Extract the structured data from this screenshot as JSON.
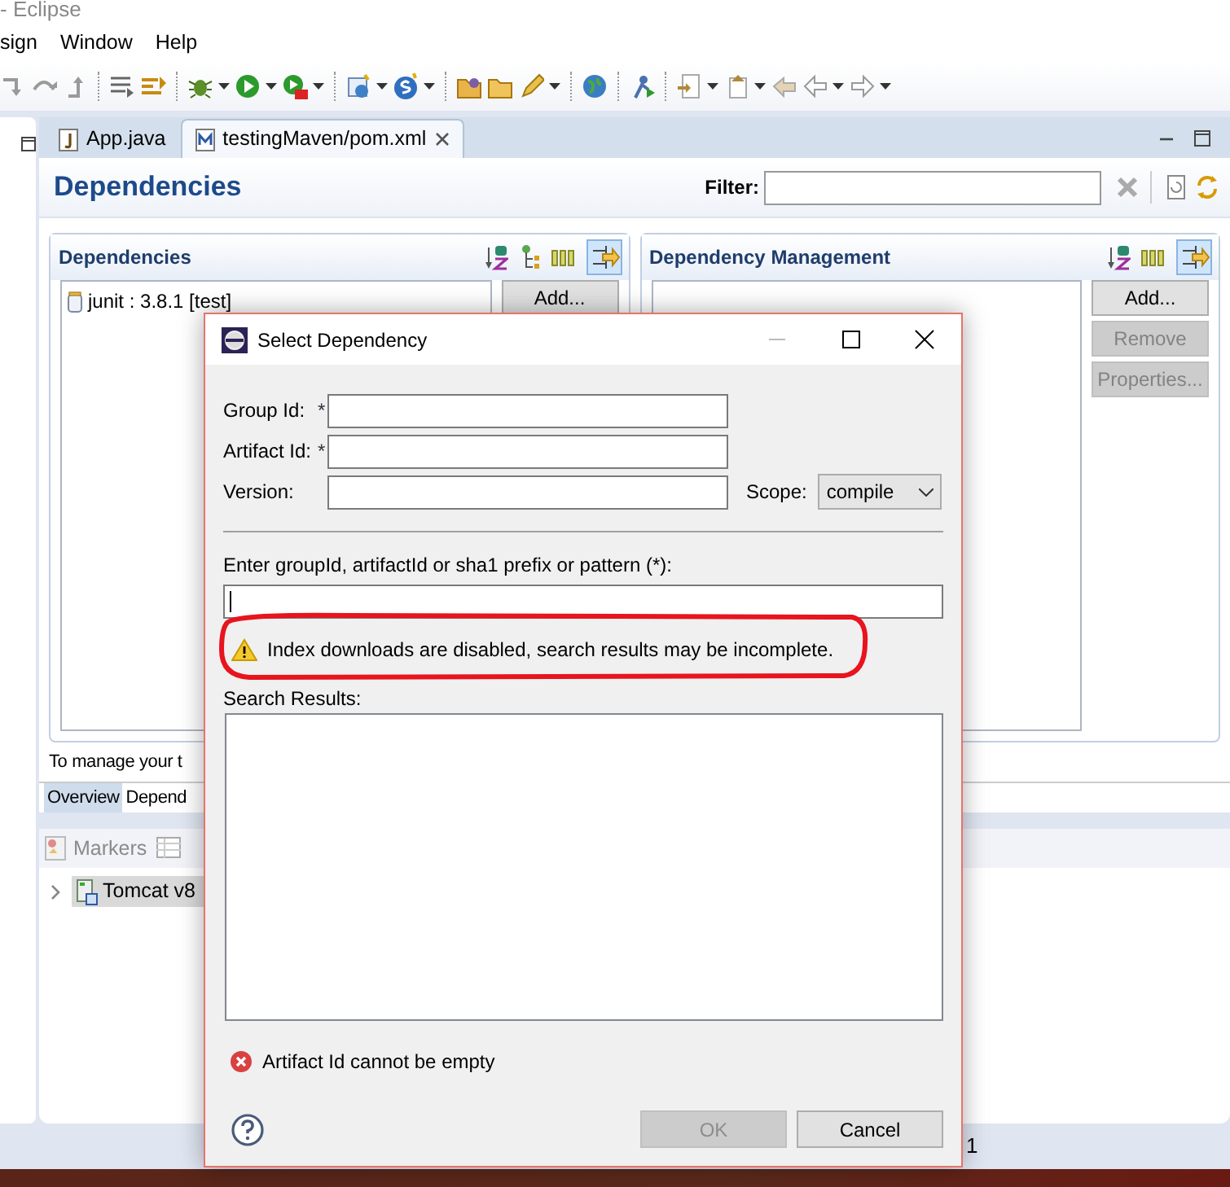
{
  "window": {
    "title": "- Eclipse"
  },
  "menu": [
    {
      "label": "sign"
    },
    {
      "label": "Window"
    },
    {
      "label": "Help"
    }
  ],
  "editor_tabs": [
    {
      "label": "App.java",
      "kind": "java",
      "selected": false,
      "closable": false
    },
    {
      "label": "testingMaven/pom.xml",
      "kind": "maven",
      "selected": true,
      "closable": true
    }
  ],
  "editor": {
    "title": "Dependencies",
    "filter_label": "Filter:"
  },
  "sections": [
    {
      "title": "Dependencies",
      "items": [
        {
          "label": "junit : 3.8.1 [test]"
        }
      ],
      "buttons": [
        {
          "label": "Add...",
          "disabled": false
        }
      ]
    },
    {
      "title": "Dependency Management",
      "buttons": [
        {
          "label": "Add...",
          "disabled": false
        },
        {
          "label": "Remove",
          "disabled": true
        },
        {
          "label": "Properties...",
          "disabled": true
        }
      ]
    }
  ],
  "footer_text": "To manage your t",
  "page_tabs": [
    {
      "label": "Overview",
      "selected": true
    },
    {
      "label": "Depend",
      "selected": false
    }
  ],
  "views": {
    "tabs": [
      {
        "label": "Markers",
        "kind": "markers"
      },
      {
        "kind": "table"
      }
    ],
    "tree": [
      {
        "label": "Tomcat v8",
        "expanded": false,
        "selected": true
      }
    ]
  },
  "status_bar": {
    "text": "1"
  },
  "dialog": {
    "title": "Select Dependency",
    "fields": [
      {
        "label": "Group Id:",
        "required_mark": "*"
      },
      {
        "label": "Artifact Id:",
        "required_mark": "*"
      },
      {
        "label": "Version:"
      }
    ],
    "scope": {
      "label": "Scope:",
      "value": "compile"
    },
    "pattern_label": "Enter groupId, artifactId or sha1 prefix or pattern (*):",
    "warning": "Index downloads are disabled, search results may be incomplete.",
    "results_label": "Search Results:",
    "error": "Artifact Id cannot be empty",
    "buttons": [
      {
        "label": "OK",
        "disabled": true
      },
      {
        "label": "Cancel",
        "disabled": false
      }
    ]
  }
}
